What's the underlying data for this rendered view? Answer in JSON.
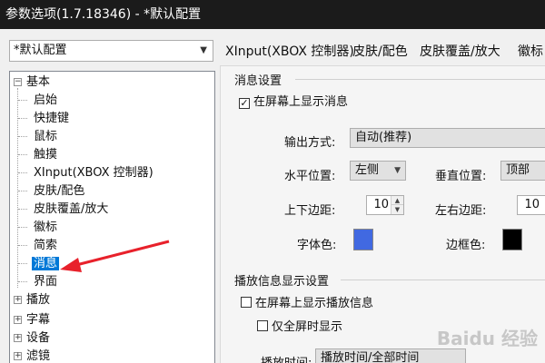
{
  "window": {
    "title": "参数选项(1.7.18346) - *默认配置"
  },
  "profile": {
    "selected": "*默认配置"
  },
  "tree": {
    "groups": [
      {
        "label": "基本",
        "expander": "−"
      },
      {
        "label": "播放",
        "expander": "+"
      },
      {
        "label": "字幕",
        "expander": "+"
      },
      {
        "label": "设备",
        "expander": "+"
      },
      {
        "label": "滤镜",
        "expander": "+"
      }
    ],
    "children": [
      "启始",
      "快捷键",
      "鼠标",
      "触摸",
      "XInput(XBOX 控制器)",
      "皮肤/配色",
      "皮肤覆盖/放大",
      "徽标",
      "简索",
      "消息",
      "界面"
    ],
    "selected_index": 9
  },
  "tabs": [
    "XInput(XBOX 控制器)",
    "皮肤/配色",
    "皮肤覆盖/放大",
    "徽标"
  ],
  "message_group": {
    "title": "消息设置",
    "show_on_screen": {
      "label": "在屏幕上显示消息",
      "checked": true,
      "mark": "✓"
    },
    "output_mode": {
      "label": "输出方式:",
      "value": "自动(推荐)"
    },
    "h_position": {
      "label": "水平位置:",
      "value": "左侧"
    },
    "v_position": {
      "label": "垂直位置:",
      "value": "顶部"
    },
    "v_margin": {
      "label": "上下边距:",
      "value": "10"
    },
    "h_margin": {
      "label": "左右边距:",
      "value": "10"
    },
    "font_color": {
      "label": "字体色:",
      "color": "#4169e1"
    },
    "border_color": {
      "label": "边框色:",
      "color": "#000000"
    }
  },
  "playback_group": {
    "title": "播放信息显示设置",
    "show_play_info": {
      "label": "在屏幕上显示播放信息",
      "checked": false
    },
    "fullscreen_only": {
      "label": "仅全屏时显示",
      "checked": false
    },
    "play_time": {
      "label": "播放时间:",
      "value": "播放时间/全部时间"
    }
  },
  "watermark": "Baidu 经验"
}
